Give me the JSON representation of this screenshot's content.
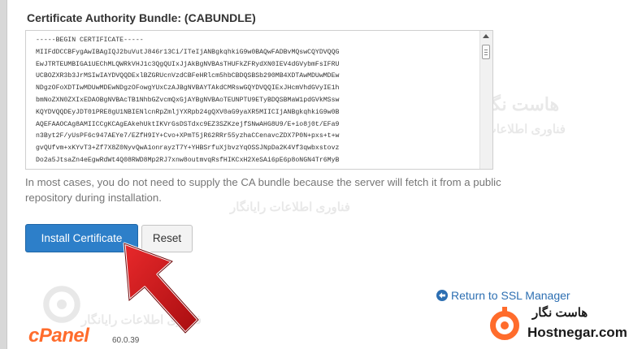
{
  "form": {
    "field_label": "Certificate Authority Bundle: (CABUNDLE)",
    "cabundle_lines": [
      "-----BEGIN CERTIFICATE-----",
      "MIIFdDCCBFygAwIBAgIQJ2buVutJ846r13Ci/ITeIjANBgkqhkiG9w0BAQwFADBvMQswCQYDVQQG",
      "EwJTRTEUMBIGA1UEChMLQWRkVHJ1c3QgQUIxJjAkBgNVBAsTHUFkZFRydXN0IEV4dGVybmFsIFRU",
      "UCBOZXR3b3JrMSIwIAYDVQQDExlBZGRUcnVzdCBFeHRlcm5hbCBDQSBSb290MB4XDTAwMDUwMDEw",
      "NDgzOFoXDTIwMDUwMDEwNDgzOFowgYUxCzAJBgNVBAYTAkdCMRswGQYDVQQIExJHcmVhdGVyIE1h",
      "bmNoZXN0ZXIxEDAOBgNVBAcTB1NhbGZvcmQxGjAYBgNVBAoTEUNPTU9ETyBDQSBMaW1pdGVkMSsw",
      "KQYDVQQDEyJDT01PRE8gU1NBIENlcnRpZmljYXRpb24gQXV0aG9yaXR5MIICIjANBgkqhkiG9w0B",
      "AQEFAAOCAg8AMIICCgKCAgEAkehUktIKVrGsDSTdxc9EZ3SZKzejfSNwAHG8U9/E+io8j0t/EFa9",
      "n3Byt2F/yUsPF6c947AEYe7/EZfH9IY+Cvo+XPmT5jR62RRr55yzhaCCenavcZDX7P0N+pxs+t+w",
      "gvQUfvm+xKYvT3+Zf7X8Z0NyvQwA1onrayzT7Y+YHBSrfuXjbvzYqOSSJNpDa2K4Vf3qwbxstovz",
      "Do2a5JtsaZn4eEgwRdWt4Q08RWD8Mp2RJ7xnw8outmvqRsfHIKCxH2XeSAi6pE6p8oNGN4Tr6MyB"
    ],
    "help_text": "In most cases, you do not need to supply the CA bundle because the server will fetch it from a public repository during installation.",
    "install_label": "Install Certificate",
    "reset_label": "Reset"
  },
  "links": {
    "return_label": "Return to SSL Manager",
    "return_icon": "circle-arrow-left-icon"
  },
  "footer": {
    "logo_text": "cPanel",
    "version": "60.0.39"
  },
  "branding": {
    "name_fa": "هاست نگار",
    "name_en": "Hostnegar.com",
    "tagline_fa": "فناوری اطلاعات رایانگار",
    "icon": "hostnegar-logo-icon"
  },
  "colors": {
    "primary_button": "#2d7fc9",
    "link": "#2d6fb2",
    "cpanel_orange": "#ff6c2c",
    "annotation_arrow": "#d0191c"
  }
}
